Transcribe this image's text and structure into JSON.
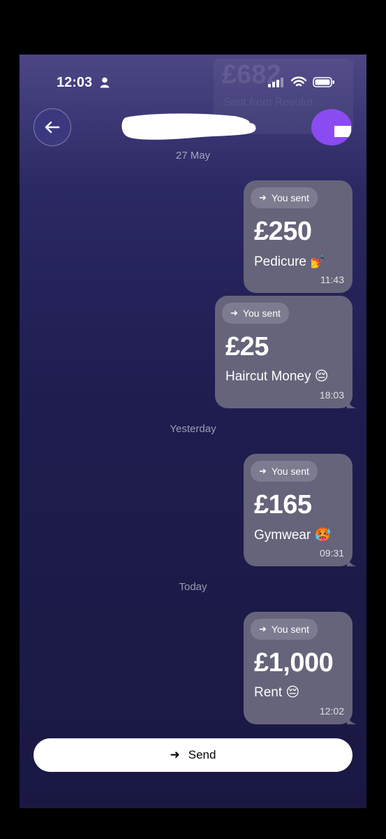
{
  "status_bar": {
    "time": "12:03"
  },
  "header_ghost": {
    "amount": "£682",
    "subtitle": "Sent from Revolut"
  },
  "messages": [
    {
      "date_label": "27 May",
      "chip": "You sent",
      "amount": "£250",
      "note": "Pedicure 💅",
      "time": "11:43"
    },
    {
      "chip": "You sent",
      "amount": "£25",
      "note": "Haircut Money 😔",
      "time": "18:03"
    },
    {
      "date_label": "Yesterday",
      "chip": "You sent",
      "amount": "£165",
      "note": "Gymwear 🥵",
      "time": "09:31"
    },
    {
      "date_label": "Today",
      "chip": "You sent",
      "amount": "£1,000",
      "note": "Rent 😔",
      "time": "12:02"
    }
  ],
  "send_button": {
    "label": "Send",
    "icon": "arrow-right-icon"
  },
  "colors": {
    "bubble": "#65647a",
    "chip": "#7c7b8f",
    "avatar": "#8a4cf0",
    "background_top": "#4c4685",
    "background_bottom": "#1a1843"
  }
}
